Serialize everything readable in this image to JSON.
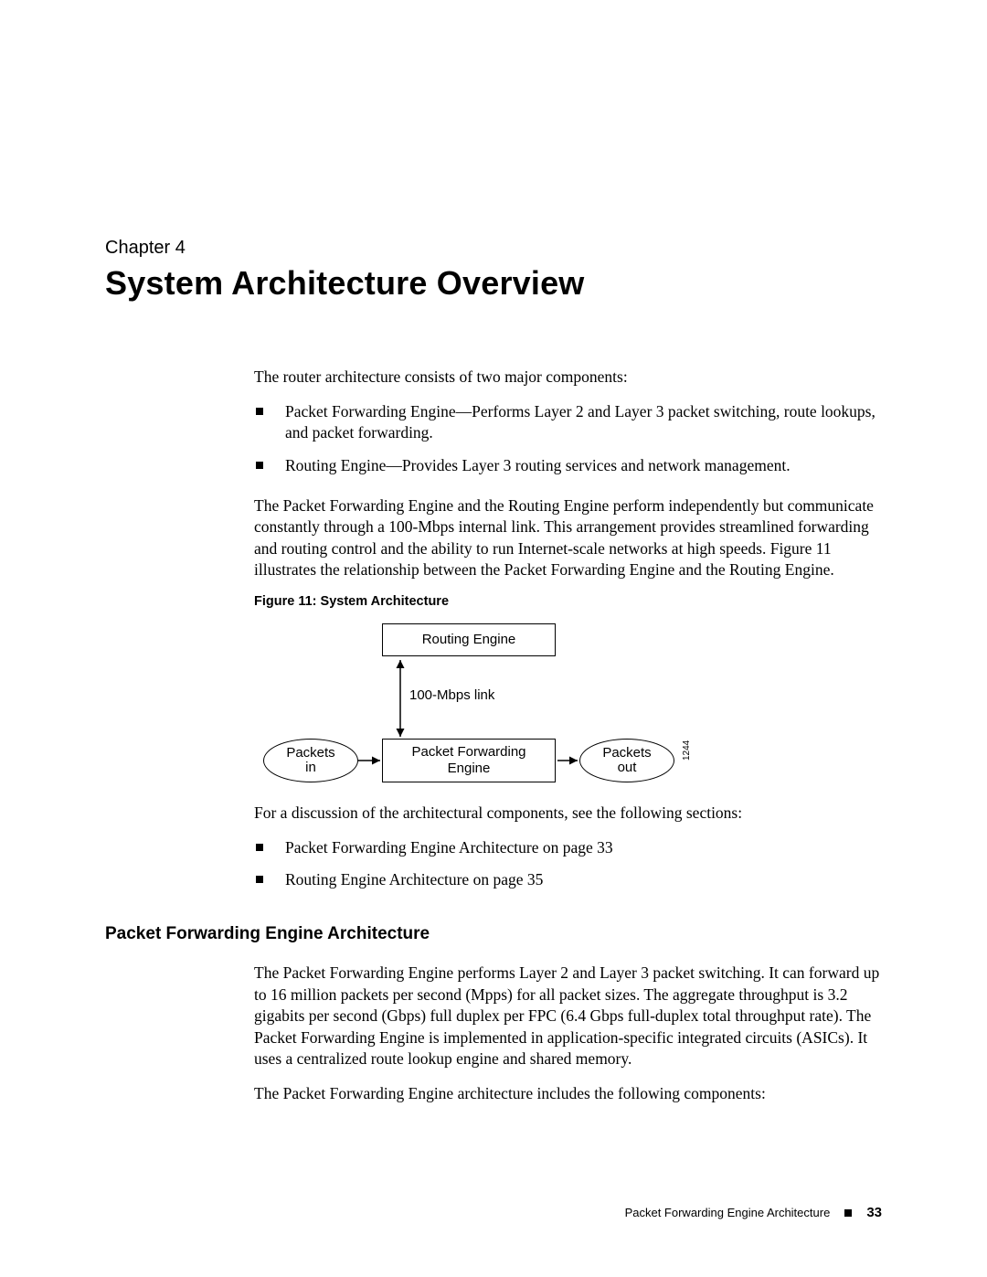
{
  "chapter": {
    "label": "Chapter 4",
    "title": "System Architecture Overview"
  },
  "intro": {
    "p1": "The router architecture consists of two major components:",
    "bullets": [
      "Packet Forwarding Engine—Performs Layer 2 and Layer 3 packet switching, route lookups, and packet forwarding.",
      "Routing Engine—Provides Layer 3 routing services and network management."
    ],
    "p2": "The Packet Forwarding Engine and the Routing Engine perform independently but communicate constantly through a 100-Mbps internal link. This arrangement provides streamlined forwarding and routing control and the ability to run Internet-scale networks at high speeds. Figure 11 illustrates the relationship between the Packet Forwarding Engine and the Routing Engine."
  },
  "figure": {
    "caption": "Figure 11: System Architecture",
    "routing_engine": "Routing Engine",
    "link_label": "100-Mbps link",
    "packets_in_l1": "Packets",
    "packets_in_l2": "in",
    "pfe_l1": "Packet Forwarding",
    "pfe_l2": "Engine",
    "packets_out_l1": "Packets",
    "packets_out_l2": "out",
    "side_code": "1244"
  },
  "after_fig": {
    "p1": "For a discussion of the architectural components, see the following sections:",
    "bullets": [
      "Packet Forwarding Engine Architecture on page 33",
      "Routing Engine Architecture on page 35"
    ]
  },
  "section": {
    "heading": "Packet Forwarding Engine Architecture",
    "p1": "The Packet Forwarding Engine performs Layer 2 and Layer 3 packet switching. It can forward up to 16 million packets per second (Mpps) for all packet sizes. The aggregate throughput is 3.2 gigabits per second (Gbps) full duplex per FPC (6.4 Gbps full-duplex total throughput rate). The Packet Forwarding Engine is implemented in application-specific integrated circuits (ASICs). It uses a centralized route lookup engine and shared memory.",
    "p2": "The Packet Forwarding Engine architecture includes the following components:"
  },
  "footer": {
    "title": "Packet Forwarding Engine Architecture",
    "page": "33"
  }
}
